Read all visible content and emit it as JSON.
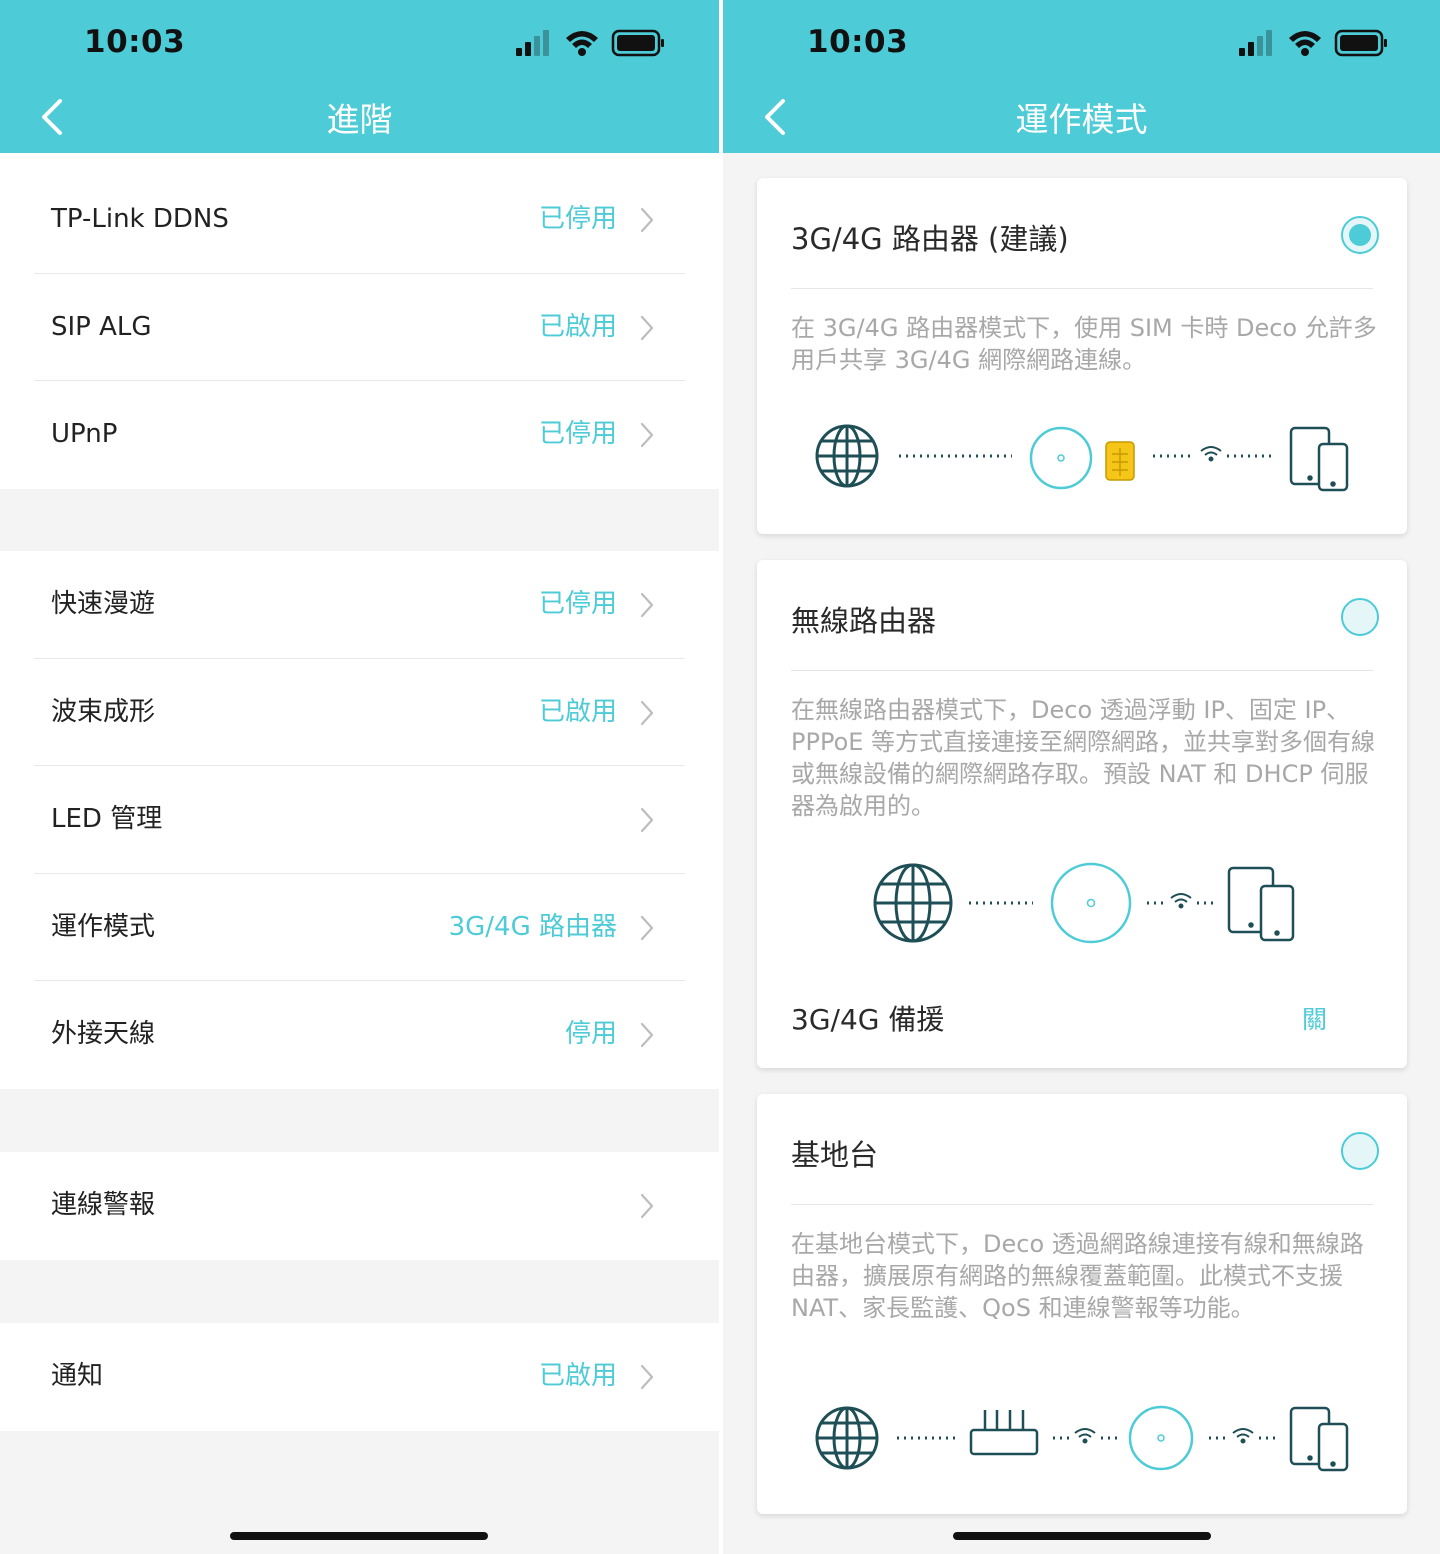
{
  "status_bar": {
    "time": "10:03"
  },
  "left_screen": {
    "title": "進階",
    "groups": [
      [
        {
          "label": "TP-Link DDNS",
          "value": "已停用"
        },
        {
          "label": "SIP ALG",
          "value": "已啟用"
        },
        {
          "label": "UPnP",
          "value": "已停用"
        }
      ],
      [
        {
          "label": "快速漫遊",
          "value": "已停用"
        },
        {
          "label": "波束成形",
          "value": "已啟用"
        },
        {
          "label": "LED 管理",
          "value": ""
        },
        {
          "label": "運作模式",
          "value": "3G/4G 路由器"
        },
        {
          "label": "外接天線",
          "value": "停用"
        }
      ],
      [
        {
          "label": "連線警報",
          "value": ""
        }
      ],
      [
        {
          "label": "通知",
          "value": "已啟用"
        }
      ]
    ]
  },
  "right_screen": {
    "title": "運作模式",
    "modes": [
      {
        "title": "3G/4G 路由器 (建議)",
        "selected": true,
        "description": "在 3G/4G 路由器模式下，使用 SIM 卡時 Deco 允許多用戶共享 3G/4G 網際網路連線。"
      },
      {
        "title": "無線路由器",
        "selected": false,
        "description": "在無線路由器模式下，Deco 透過浮動 IP、固定 IP、PPPoE 等方式直接連接至網際網路，並共享對多個有線或無線設備的網際網路存取。預設 NAT 和 DHCP 伺服器為啟用的。",
        "backup_label": "3G/4G 備援",
        "backup_value": "關"
      },
      {
        "title": "基地台",
        "selected": false,
        "description": "在基地台模式下，Deco 透過網路線連接有線和無線路由器，擴展原有網路的無線覆蓋範圍。此模式不支援 NAT、家長監護、QoS 和連線警報等功能。"
      }
    ]
  },
  "colors": {
    "accent": "#4dcbd6",
    "sim_chip": "#f5c518",
    "icon_dark": "#1f4f56"
  }
}
